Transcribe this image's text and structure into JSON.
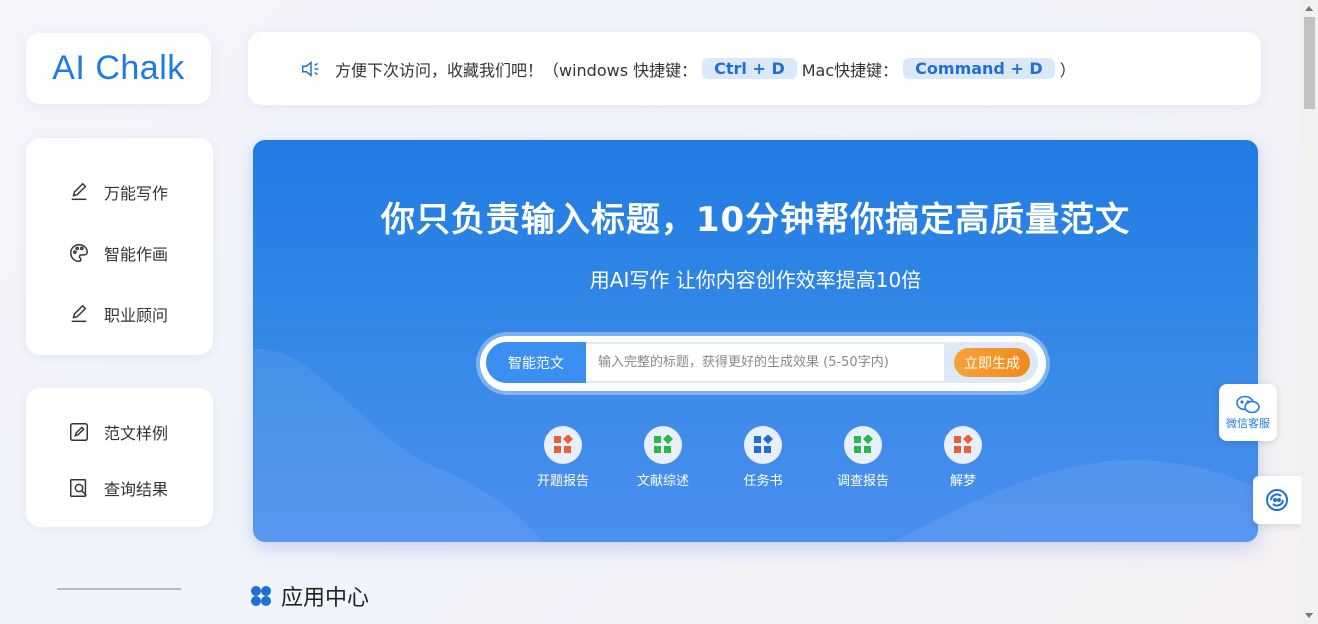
{
  "logo": {
    "text": "AI Chalk"
  },
  "nav_primary": [
    {
      "label": "万能写作",
      "icon": "pencil-icon"
    },
    {
      "label": "智能作画",
      "icon": "palette-icon"
    },
    {
      "label": "职业顾问",
      "icon": "pencil-icon"
    }
  ],
  "nav_secondary": [
    {
      "label": "范文样例",
      "icon": "edit-box-icon"
    },
    {
      "label": "查询结果",
      "icon": "search-doc-icon"
    }
  ],
  "notice": {
    "text_before": "方便下次访问，收藏我们吧！（windows 快捷键：",
    "win_shortcut": "Ctrl + D",
    "text_mid": "Mac快捷键：",
    "mac_shortcut": "Command + D",
    "text_after": "）"
  },
  "hero": {
    "title": "你只负责输入标题，10分钟帮你搞定高质量范文",
    "subtitle": "用AI写作 让你内容创作效率提高10倍",
    "mode_label": "智能范文",
    "input_placeholder": "输入完整的标题，获得更好的生成效果 (5-50字内)",
    "input_value": "",
    "generate_label": "立即生成",
    "shortcuts": [
      {
        "label": "开题报告",
        "color": "#e8603c"
      },
      {
        "label": "文献综述",
        "color": "#2bb84a"
      },
      {
        "label": "任务书",
        "color": "#1e6fd6"
      },
      {
        "label": "调查报告",
        "color": "#2bb84a"
      },
      {
        "label": "解梦",
        "color": "#e8603c"
      }
    ]
  },
  "app_center": {
    "title": "应用中心"
  },
  "float": {
    "wechat_label": "微信客服"
  },
  "colors": {
    "brand": "#1e7be6",
    "accent_orange": "#f08a1a"
  }
}
